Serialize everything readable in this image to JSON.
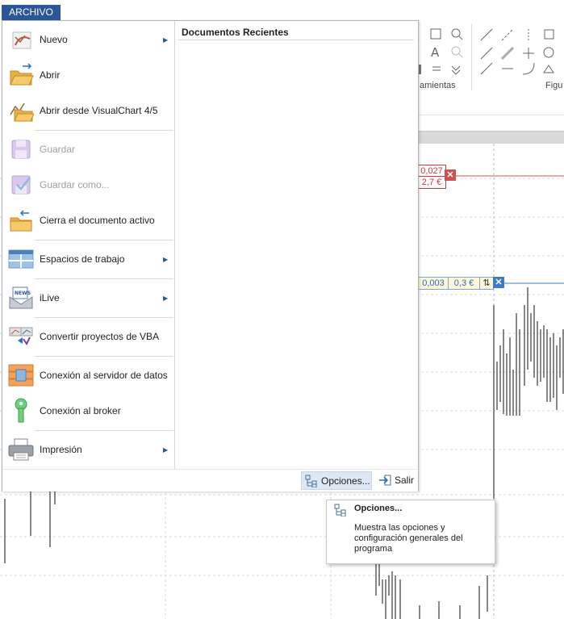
{
  "app": {
    "file_tab_label": "ARCHIVO"
  },
  "ribbon": {
    "group_labels": [
      "amientas",
      "Figu"
    ]
  },
  "chart": {
    "red_line": {
      "value": "0,027",
      "amount": "2,7 €",
      "close": "✕"
    },
    "blue_line": {
      "value": "0,003",
      "amount": "0,3 €",
      "close": "✕"
    }
  },
  "menu": {
    "items": [
      {
        "label": "Nuevo",
        "icon": "new-chart-icon",
        "submenu": true,
        "enabled": true
      },
      {
        "label": "Abrir",
        "icon": "open-folder-icon",
        "submenu": false,
        "enabled": true
      },
      {
        "label": "Abrir desde VisualChart 4/5",
        "icon": "open-visualchart-icon",
        "submenu": false,
        "enabled": true
      },
      {
        "label": "Guardar",
        "icon": "save-icon",
        "submenu": false,
        "enabled": false
      },
      {
        "label": "Guardar como...",
        "icon": "save-as-icon",
        "submenu": false,
        "enabled": false
      },
      {
        "label": "Cierra el documento activo",
        "icon": "close-document-icon",
        "submenu": false,
        "enabled": true
      },
      {
        "label": "Espacios de trabajo",
        "icon": "workspaces-icon",
        "submenu": true,
        "enabled": true
      },
      {
        "label": "iLive",
        "icon": "news-icon",
        "submenu": true,
        "enabled": true
      },
      {
        "label": "Convertir proyectos de VBA",
        "icon": "convert-vba-icon",
        "submenu": false,
        "enabled": true
      },
      {
        "label": "Conexión al servidor de datos",
        "icon": "data-server-icon",
        "submenu": false,
        "enabled": true
      },
      {
        "label": "Conexión al broker",
        "icon": "broker-key-icon",
        "submenu": false,
        "enabled": true
      },
      {
        "label": "Impresión",
        "icon": "printer-icon",
        "submenu": true,
        "enabled": true
      }
    ],
    "recent_title": "Documentos Recientes",
    "options_label": "Opciones...",
    "exit_label": "Salir"
  },
  "tooltip": {
    "title": "Opciones...",
    "description": "Muestra las opciones y configuración generales del programa"
  }
}
